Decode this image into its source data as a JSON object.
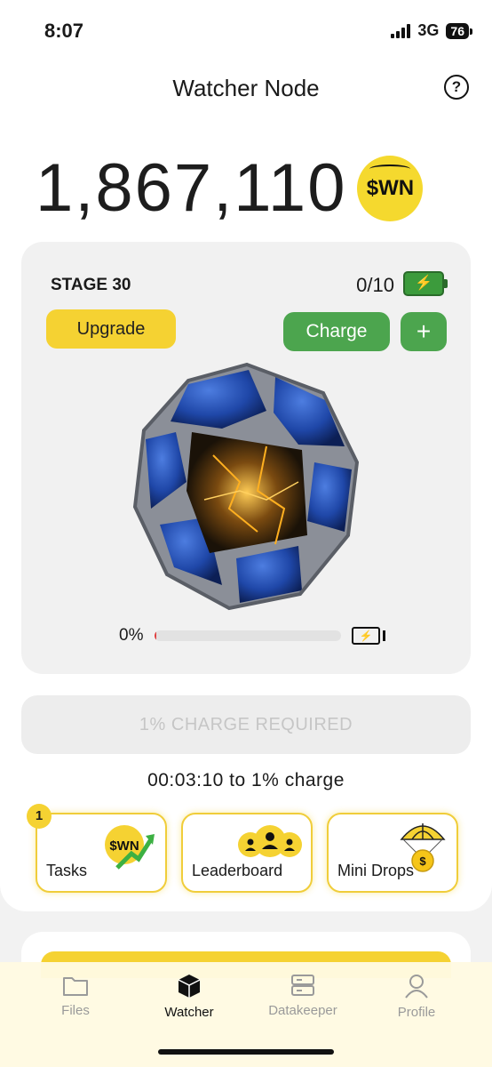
{
  "status_bar": {
    "time": "8:07",
    "network": "3G",
    "battery": "76"
  },
  "header": {
    "title": "Watcher Node",
    "help_icon": "question-circle-icon"
  },
  "balance": {
    "amount": "1,867,110",
    "token": "$WN"
  },
  "stage": {
    "label": "STAGE 30",
    "charges": "0/10",
    "upgrade_label": "Upgrade",
    "charge_label": "Charge",
    "plus_label": "+",
    "progress_label": "0%",
    "progress_value": 0.01
  },
  "charge_required_label": "1% CHARGE REQUIRED",
  "timer_text": "00:03:10 to 1% charge",
  "tiles": [
    {
      "label": "Tasks",
      "badge": "1",
      "icon": "wn-coin-chart-icon",
      "coin": "$WN"
    },
    {
      "label": "Leaderboard",
      "icon": "leaderboard-users-icon"
    },
    {
      "label": "Mini Drops",
      "icon": "parachute-coin-icon",
      "coin": "$"
    }
  ],
  "tabs": [
    {
      "label": "Files",
      "icon": "folder-icon"
    },
    {
      "label": "Watcher",
      "icon": "cube-icon",
      "active": true
    },
    {
      "label": "Datakeeper",
      "icon": "server-icon"
    },
    {
      "label": "Profile",
      "icon": "user-icon"
    }
  ],
  "colors": {
    "accent_yellow": "#f5d232",
    "charge_green": "#4ca54e",
    "node_blue": "#1f47a8",
    "glow_orange": "#ffb020"
  }
}
